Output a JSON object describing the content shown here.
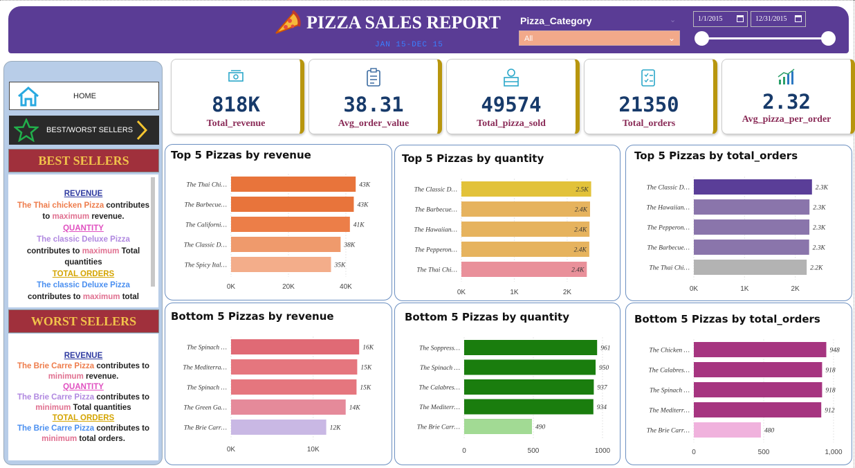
{
  "header": {
    "title": "PIZZA SALES REPORT",
    "subtitle": "JAN 15-DEC 15",
    "filter_label": "Pizza_Category",
    "filter_value": "All",
    "date_start": "1/1/2015",
    "date_end": "12/31/2015"
  },
  "nav": {
    "home_label": "HOME",
    "bestworst_label": "BEST/WORST SELLERS"
  },
  "best": {
    "heading": "BEST SELLERS",
    "revenue_h": "REVENUE",
    "revenue_pizza": "The Thai chicken Pizza",
    "revenue_t1": " contributes to ",
    "revenue_max": "maximum",
    "revenue_t2": " revenue.",
    "quantity_h": "QUANTITY",
    "quantity_pizza": "The classic Deluxe Pizza",
    "quantity_t1": " contributes to ",
    "quantity_max": "maximum",
    "quantity_t2": " Total quantities",
    "orders_h": "TOTAL ORDERS",
    "orders_pizza": "The classic Deluxe Pizza",
    "orders_t1": " contributes to ",
    "orders_max": "maximum",
    "orders_t2": " total"
  },
  "worst": {
    "heading": "WORST SELLERS",
    "revenue_h": "REVENUE",
    "revenue_pizza": "The Brie Carre Pizza",
    "revenue_t1": " contributes to ",
    "revenue_min": "minimum",
    "revenue_t2": " revenue.",
    "quantity_h": "QUANTITY",
    "quantity_pizza": "The Brie Carre Pizza",
    "quantity_t1": " contributes to ",
    "quantity_min": "minimum",
    "quantity_t2": " Total quantities",
    "orders_h": "TOTAL ORDERS",
    "orders_pizza": "The Brie Carre Pizza",
    "orders_t1": " contributes to ",
    "orders_min": "minimum",
    "orders_t2": " total orders."
  },
  "kpis": [
    {
      "value": "818K",
      "label": "Total_revenue",
      "icon": "money-icon"
    },
    {
      "value": "38.31",
      "label": "Avg_order_value",
      "icon": "clipboard-icon"
    },
    {
      "value": "49574",
      "label": "Total_pizza_sold",
      "icon": "delivery-icon"
    },
    {
      "value": "21350",
      "label": "Total_orders",
      "icon": "checklist-icon"
    },
    {
      "value": "2.32",
      "label": "Avg_pizza_per_order",
      "icon": "growth-chart-icon"
    }
  ],
  "colors": {
    "header_bg": "#5a3c95",
    "kpi_value": "#173a6a",
    "kpi_label": "#8a2b57"
  },
  "chart_data": [
    {
      "id": "c1",
      "type": "bar",
      "orientation": "horizontal",
      "title": "Top 5 Pizzas by revenue",
      "categories": [
        "The Thai Chi…",
        "The Barbecue…",
        "The Californi…",
        "The Classic D…",
        "The Spicy Ital…"
      ],
      "values": [
        43434,
        42768,
        41410,
        38180,
        34831
      ],
      "data_labels": [
        "43K",
        "43K",
        "41K",
        "38K",
        "35K"
      ],
      "colors": [
        "#e8743b",
        "#e8743b",
        "#ec7e48",
        "#ef9a6c",
        "#f3ad8a"
      ],
      "ticks": [
        0,
        20000,
        40000
      ],
      "tick_labels": [
        "0K",
        "20K",
        "40K"
      ],
      "xlim": [
        0,
        47000
      ]
    },
    {
      "id": "c2",
      "type": "bar",
      "orientation": "horizontal",
      "title": "Top 5 Pizzas by quantity",
      "categories": [
        "The Classic D…",
        "The Barbecue…",
        "The Hawaiian…",
        "The Pepperon…",
        "The Thai Chi…"
      ],
      "values": [
        2453,
        2432,
        2422,
        2418,
        2371
      ],
      "data_labels": [
        "2.5K",
        "2.4K",
        "2.4K",
        "2.4K",
        "2.4K"
      ],
      "colors": [
        "#e2c23a",
        "#e6b35e",
        "#e6b35e",
        "#e6b35e",
        "#e9909a"
      ],
      "ticks": [
        0,
        1000,
        2000
      ],
      "tick_labels": [
        "0K",
        "1K",
        "2K"
      ],
      "xlim": [
        0,
        2550
      ]
    },
    {
      "id": "c3",
      "type": "bar",
      "orientation": "horizontal",
      "title": "Top 5 Pizzas by total_orders",
      "categories": [
        "The Classic D…",
        "The Hawaiian…",
        "The Pepperon…",
        "The Barbecue…",
        "The Thai Chi…"
      ],
      "values": [
        2329,
        2280,
        2278,
        2273,
        2225
      ],
      "data_labels": [
        "2.3K",
        "2.3K",
        "2.3K",
        "2.3K",
        "2.2K"
      ],
      "colors": [
        "#5a3e98",
        "#8a75ab",
        "#8a75ab",
        "#8a75ab",
        "#b3b3b3"
      ],
      "ticks": [
        0,
        1000,
        2000
      ],
      "tick_labels": [
        "0K",
        "1K",
        "2K"
      ],
      "xlim": [
        0,
        2550
      ]
    },
    {
      "id": "c4",
      "type": "bar",
      "orientation": "horizontal",
      "title": "Bottom 5 Pizzas by revenue",
      "categories": [
        "The Spinach …",
        "The Mediterra…",
        "The Spinach …",
        "The Green Ga…",
        "The Brie Carr…"
      ],
      "values": [
        15596,
        15360,
        15277,
        13956,
        11588
      ],
      "data_labels": [
        "16K",
        "15K",
        "15K",
        "14K",
        "12K"
      ],
      "colors": [
        "#e06a75",
        "#e5767e",
        "#e5767e",
        "#e58a9a",
        "#c9b8e4"
      ],
      "ticks": [
        0,
        10000
      ],
      "tick_labels": [
        "0K",
        "10K"
      ],
      "xlim": [
        0,
        16000
      ]
    },
    {
      "id": "c5",
      "type": "bar",
      "orientation": "horizontal",
      "title": "Bottom 5 Pizzas by quantity",
      "categories": [
        "The Soppress…",
        "The Spinach …",
        "The Calabres…",
        "The Mediterr…",
        "The Brie Carr…"
      ],
      "values": [
        961,
        950,
        937,
        934,
        490
      ],
      "data_labels": [
        "961",
        "950",
        "937",
        "934",
        "490"
      ],
      "colors": [
        "#1a7d0e",
        "#1a7d0e",
        "#1a7d0e",
        "#1a7d0e",
        "#a2da94"
      ],
      "ticks": [
        0,
        500,
        1000
      ],
      "tick_labels": [
        "0",
        "500",
        "1000"
      ],
      "xlim": [
        0,
        1000
      ]
    },
    {
      "id": "c6",
      "type": "bar",
      "orientation": "horizontal",
      "title": "Bottom 5 Pizzas by total_orders",
      "categories": [
        "The Chicken …",
        "The Calabres…",
        "The Spinach …",
        "The Mediterr…",
        "The Brie Carr…"
      ],
      "values": [
        948,
        918,
        918,
        912,
        480
      ],
      "data_labels": [
        "948",
        "918",
        "918",
        "912",
        "480"
      ],
      "colors": [
        "#a63580",
        "#a63580",
        "#a63580",
        "#a63580",
        "#f0b2dd"
      ],
      "ticks": [
        0,
        500,
        1000
      ],
      "tick_labels": [
        "0",
        "500",
        "1,000"
      ],
      "xlim": [
        0,
        1000
      ]
    }
  ]
}
